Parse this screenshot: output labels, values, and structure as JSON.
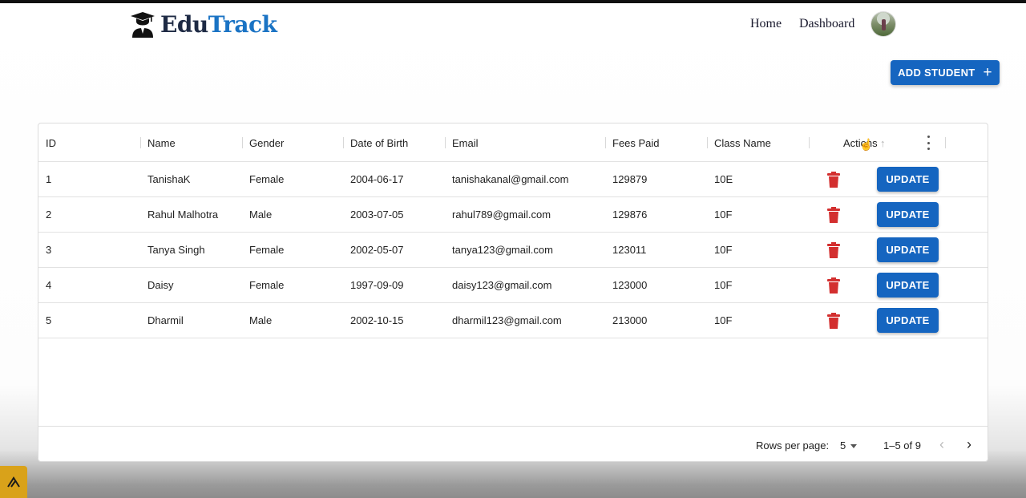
{
  "brand": {
    "part1": "Edu",
    "part2": "Track"
  },
  "nav": {
    "home": "Home",
    "dashboard": "Dashboard"
  },
  "add_button": {
    "label": "ADD STUDENT",
    "icon": "+"
  },
  "table": {
    "columns": [
      "ID",
      "Name",
      "Gender",
      "Date of Birth",
      "Email",
      "Fees Paid",
      "Class Name",
      "Actions"
    ],
    "rows": [
      [
        "1",
        "TanishaK",
        "Female",
        "2004-06-17",
        "tanishakanal@gmail.com",
        "129879",
        "10E"
      ],
      [
        "2",
        "Rahul Malhotra",
        "Male",
        "2003-07-05",
        "rahul789@gmail.com",
        "129876",
        "10F"
      ],
      [
        "3",
        "Tanya Singh",
        "Female",
        "2002-05-07",
        "tanya123@gmail.com",
        "123011",
        "10F"
      ],
      [
        "4",
        "Daisy",
        "Female",
        "1997-09-09",
        "daisy123@gmail.com",
        "123000",
        "10F"
      ],
      [
        "5",
        "Dharmil",
        "Male",
        "2002-10-15",
        "dharmil123@gmail.com",
        "213000",
        "10F"
      ]
    ],
    "update_label": "UPDATE"
  },
  "pagination": {
    "rows_per_page_label": "Rows per page:",
    "rows_per_page_value": "5",
    "range": "1–5 of 9"
  },
  "colors": {
    "primary": "#1565c0",
    "delete": "#d32f2f",
    "brand_dark": "#1e2a44",
    "brand_blue": "#1a73c4"
  },
  "icons": {
    "logo": "graduate-icon",
    "delete": "trash-icon",
    "sort": "arrow-up-icon",
    "menu": "more-vert-icon",
    "prev": "chevron-left-icon",
    "next": "chevron-right-icon"
  }
}
